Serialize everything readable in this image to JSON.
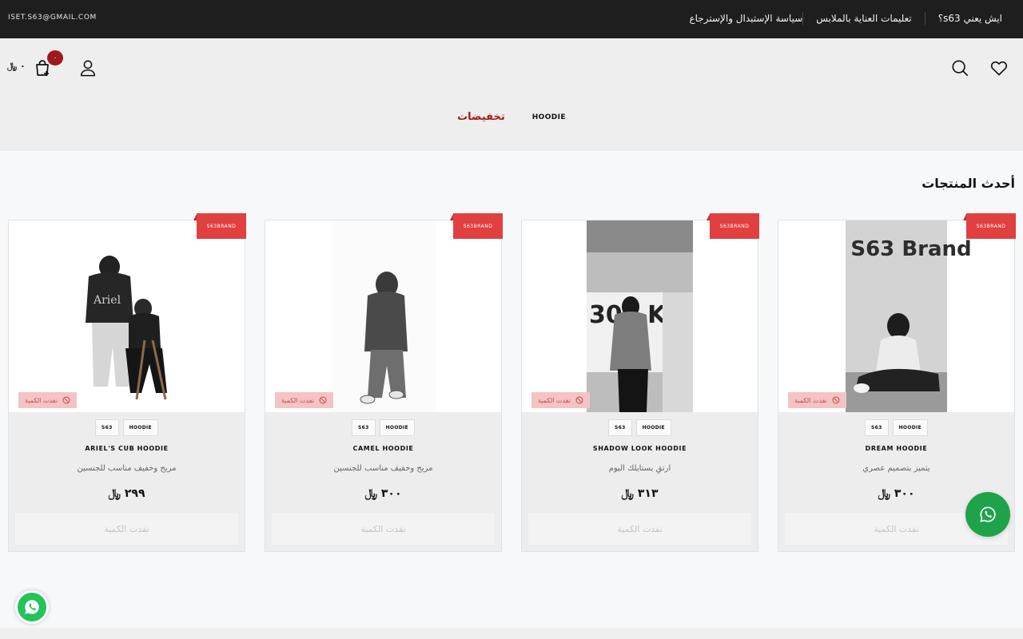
{
  "topbar": {
    "email": "ISET.S63@GMAIL.COM",
    "links": [
      "سياسة الإستبدال والإسترجاع",
      "تعليمات العناية بالملابس",
      "ايش يعني s63؟"
    ]
  },
  "header": {
    "cart_count": "٠",
    "cart_total": "٠ ﷼",
    "nav": {
      "sale": "تخفيضات",
      "hoodie": "HOODIE"
    }
  },
  "section": {
    "title": "أحدث المنتجات"
  },
  "products": [
    {
      "ribbon": "S63BRAND",
      "oos_badge": "نفدت الكمية",
      "tags": [
        "S63",
        "HOODIE"
      ],
      "title": "DREAM HOODIE",
      "desc": "يتميز بتصميم عصري",
      "price": "٣٠٠ ﷼",
      "cta": "نفدت الكمية",
      "image_text": "S63 Brand"
    },
    {
      "ribbon": "S63BRAND",
      "oos_badge": "نفدت الكمية",
      "tags": [
        "S63",
        "HOODIE"
      ],
      "title": "SHADOW LOOK HOODIE",
      "desc": "ارتقِ بستايلك اليوم",
      "price": "٣١٣ ﷼",
      "cta": "نفدت الكمية",
      "image_text": "303 KG"
    },
    {
      "ribbon": "S63BRAND",
      "oos_badge": "نفدت الكمية",
      "tags": [
        "S63",
        "HOODIE"
      ],
      "title": "CAMEL HOODIE",
      "desc": "مريح وخفيف مناسب للجنسين",
      "price": "٣٠٠ ﷼",
      "cta": "نفدت الكمية",
      "image_text": ""
    },
    {
      "ribbon": "S63BRAND",
      "oos_badge": "نفدت الكمية",
      "tags": [
        "S63",
        "HOODIE"
      ],
      "title": "ARIEL'S CUB HOODIE",
      "desc": "مريح وخفيف مناسب للجنسين",
      "price": "٢٩٩ ﷼",
      "cta": "نفدت الكمية",
      "image_text": "Ariel"
    }
  ],
  "colors": {
    "accent": "#9e1b1b",
    "ribbon": "#e0403f",
    "whatsapp": "#1ea34a"
  },
  "icons": [
    "heart-icon",
    "search-icon",
    "user-icon",
    "cart-icon",
    "ban-icon",
    "whatsapp-icon"
  ]
}
